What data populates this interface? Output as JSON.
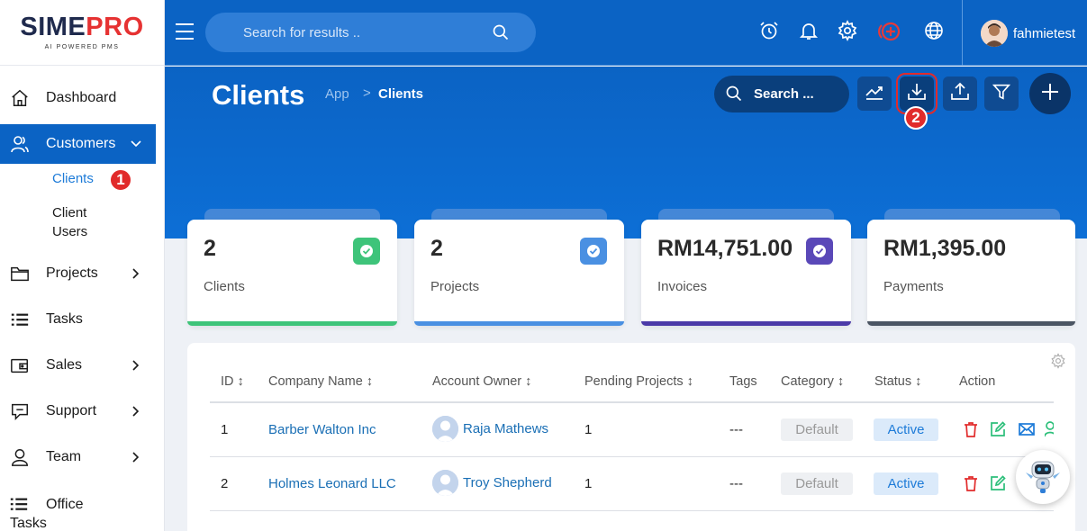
{
  "app": {
    "logo_main_1": "SIME",
    "logo_main_2": "PRO",
    "logo_sub": "AI POWERED PMS"
  },
  "topbar": {
    "search_placeholder": "Search for results ..",
    "username": "fahmietest",
    "icons": [
      "menu-icon",
      "search-icon",
      "alarm-clock-icon",
      "bell-icon",
      "gear-icon",
      "add-circle-icon",
      "globe-icon"
    ]
  },
  "sidebar": {
    "items": [
      {
        "label": "Dashboard",
        "icon": "home-icon"
      },
      {
        "label": "Customers",
        "icon": "users-icon",
        "active": true
      },
      {
        "label": "Projects",
        "icon": "folder-icon"
      },
      {
        "label": "Tasks",
        "icon": "list-icon"
      },
      {
        "label": "Sales",
        "icon": "wallet-icon"
      },
      {
        "label": "Support",
        "icon": "chat-icon"
      },
      {
        "label": "Team",
        "icon": "user-icon"
      },
      {
        "label": "Office Tasks",
        "icon": "list-icon"
      }
    ],
    "sub_items": [
      {
        "label": "Clients"
      },
      {
        "label": "Client Users"
      }
    ]
  },
  "markers": {
    "one": "1",
    "two": "2"
  },
  "page": {
    "title": "Clients",
    "breadcrumb_app": "App",
    "breadcrumb_sep": ">",
    "breadcrumb_current": "Clients",
    "search_label": "Search ...",
    "toolbar_icons": [
      "trend-chart-icon",
      "download-icon",
      "upload-icon",
      "filter-icon",
      "plus-icon"
    ]
  },
  "stats": [
    {
      "value": "2",
      "label": "Clients",
      "color": "#3ec47a"
    },
    {
      "value": "2",
      "label": "Projects",
      "color": "#4a90e2"
    },
    {
      "value": "RM14,751.00",
      "label": "Invoices",
      "color": "#4b3aa8"
    },
    {
      "value": "RM1,395.00",
      "label": "Payments",
      "color": "#4b5563"
    }
  ],
  "table": {
    "columns": [
      "ID ↕",
      "Company Name ↕",
      "Account Owner ↕",
      "Pending Projects ↕",
      "Tags",
      "Category ↕",
      "Status ↕",
      "Action"
    ],
    "rows": [
      {
        "id": "1",
        "company": "Barber Walton Inc",
        "owner": "Raja Mathews",
        "pending": "1",
        "tags": "---",
        "category": "Default",
        "status": "Active"
      },
      {
        "id": "2",
        "company": "Holmes Leonard LLC",
        "owner": "Troy Shepherd",
        "pending": "1",
        "tags": "---",
        "category": "Default",
        "status": "Active"
      }
    ]
  },
  "colors": {
    "primary": "#0b63c4",
    "danger": "#e12b2b",
    "success": "#2cbf7a"
  }
}
